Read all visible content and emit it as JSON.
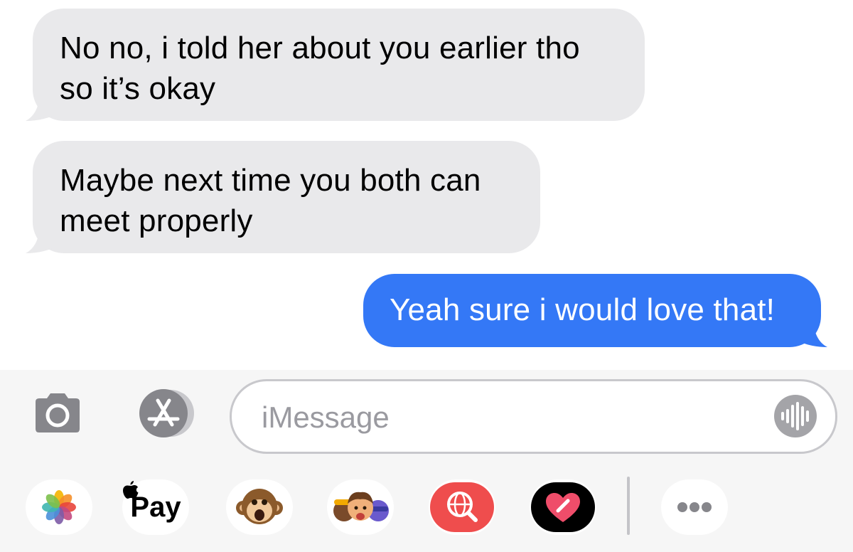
{
  "messages": [
    {
      "direction": "received",
      "lines": [
        "No no, i told her about you earlier tho",
        "so it’s okay"
      ]
    },
    {
      "direction": "received",
      "lines": [
        "Maybe next time you both can",
        "meet properly"
      ]
    },
    {
      "direction": "sent",
      "text": "Yeah sure i would love that!"
    }
  ],
  "composer": {
    "placeholder": "iMessage",
    "camera_icon": "camera-icon",
    "appstore_icon": "app-store-icon",
    "audio_icon": "audio-waveform-icon"
  },
  "app_drawer": {
    "items": [
      {
        "name": "photos",
        "icon": "photos-flower-icon"
      },
      {
        "name": "apple-pay",
        "label": "Pay",
        "icon": "apple-logo-icon"
      },
      {
        "name": "animoji",
        "icon": "monkey-animoji-icon"
      },
      {
        "name": "memoji-stickers",
        "icon": "memoji-faces-icon"
      },
      {
        "name": "images-search",
        "icon": "globe-search-icon"
      },
      {
        "name": "digital-touch",
        "icon": "heart-touch-icon"
      },
      {
        "name": "more",
        "icon": "ellipsis-icon"
      }
    ]
  },
  "colors": {
    "sent_bubble": "#3478f6",
    "received_bubble": "#e9e9eb",
    "composer_bg": "#f6f6f6"
  }
}
